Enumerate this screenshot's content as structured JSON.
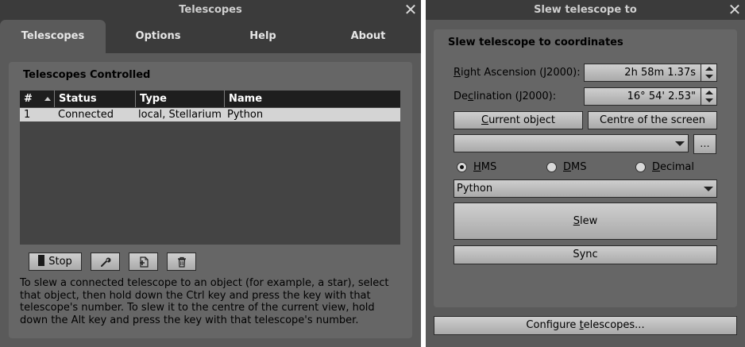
{
  "left_window": {
    "title": "Telescopes",
    "close_glyph": "✕",
    "tabs": [
      {
        "label": "Telescopes",
        "active": true
      },
      {
        "label": "Options",
        "active": false
      },
      {
        "label": "Help",
        "active": false
      },
      {
        "label": "About",
        "active": false
      }
    ],
    "section_title": "Telescopes Controlled",
    "table": {
      "columns": [
        "#",
        "Status",
        "Type",
        "Name"
      ],
      "rows": [
        {
          "num": "1",
          "status": "Connected",
          "type": "local, Stellarium",
          "name": "Python"
        }
      ]
    },
    "buttons": {
      "stop_label": "Stop",
      "configure_icon": "wrench-icon",
      "add_icon": "add-document-icon",
      "remove_icon": "trash-icon"
    },
    "help_text": "To slew a connected telescope to an object (for example, a star), select that object, then hold down the Ctrl key and press the key with that telescope's number. To slew it to the centre of the current view, hold down the Alt key and press the key with that telescope's number."
  },
  "right_window": {
    "title": "Slew telescope to",
    "close_glyph": "✕",
    "section_title": "Slew telescope to coordinates",
    "ra": {
      "label_first": "R",
      "label_rest": "ight Ascension (J2000):",
      "value": "2h 58m 1.37s"
    },
    "dec": {
      "label_first": "De",
      "label_u": "c",
      "label_rest": "lination (J2000):",
      "value": "16° 54' 2.53\""
    },
    "current_object": {
      "pre": "",
      "u": "C",
      "post": "urrent object"
    },
    "centre_of_screen": "Centre of the screen",
    "coords_combo_value": "",
    "ellipsis": "...",
    "radios": [
      {
        "u": "H",
        "rest": "MS",
        "checked": true
      },
      {
        "u": "D",
        "rest": "MS",
        "checked": false
      },
      {
        "u": "D",
        "rest": "ecimal",
        "checked": false
      }
    ],
    "telescope_combo_value": "Python",
    "slew": {
      "u": "S",
      "rest": "lew"
    },
    "sync": "Sync",
    "configure": {
      "pre": "Configure ",
      "u": "t",
      "post": "elescopes..."
    }
  },
  "colors": {
    "window_bg": "#5a5a5a",
    "titlebar_bg": "#3b3b3b",
    "panel_bg": "#666666",
    "table_header_bg": "#1e1e1e",
    "selected_row_bg": "#d4d4d4"
  }
}
